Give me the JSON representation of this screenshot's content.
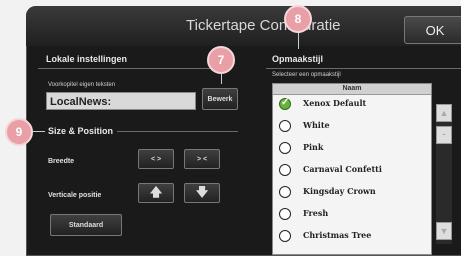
{
  "window": {
    "title": "Tickertape Configuratie",
    "ok_label": "OK"
  },
  "local": {
    "section_title": "Lokale instellingen",
    "field_label": "Voorkopitel eigen teksten",
    "input_value": "LocalNews:",
    "edit_label": "Bewerk"
  },
  "size_position": {
    "section_title": "Size & Position",
    "width_label": "Breedte",
    "vertical_label": "Verticale positie",
    "widen_label": "< >",
    "narrow_label": "> <",
    "standard_label": "Standaard"
  },
  "style": {
    "section_title": "Opmaakstijl",
    "select_label": "Selecteer een opmaakstijl",
    "column_header": "Naam",
    "items": [
      {
        "label": "Xenox Default",
        "checked": true
      },
      {
        "label": "White",
        "checked": false
      },
      {
        "label": "Pink",
        "checked": false
      },
      {
        "label": "Carnaval Confetti",
        "checked": false
      },
      {
        "label": "Kingsday Crown",
        "checked": false
      },
      {
        "label": "Fresh",
        "checked": false
      },
      {
        "label": "Christmas Tree",
        "checked": false
      }
    ]
  },
  "callouts": {
    "badge_7": "7",
    "badge_8": "8",
    "badge_9": "9"
  },
  "colors": {
    "badge": "#e8a0a6",
    "window_bg": "#1a1a1a",
    "checked_radio": "#6ab23d"
  }
}
